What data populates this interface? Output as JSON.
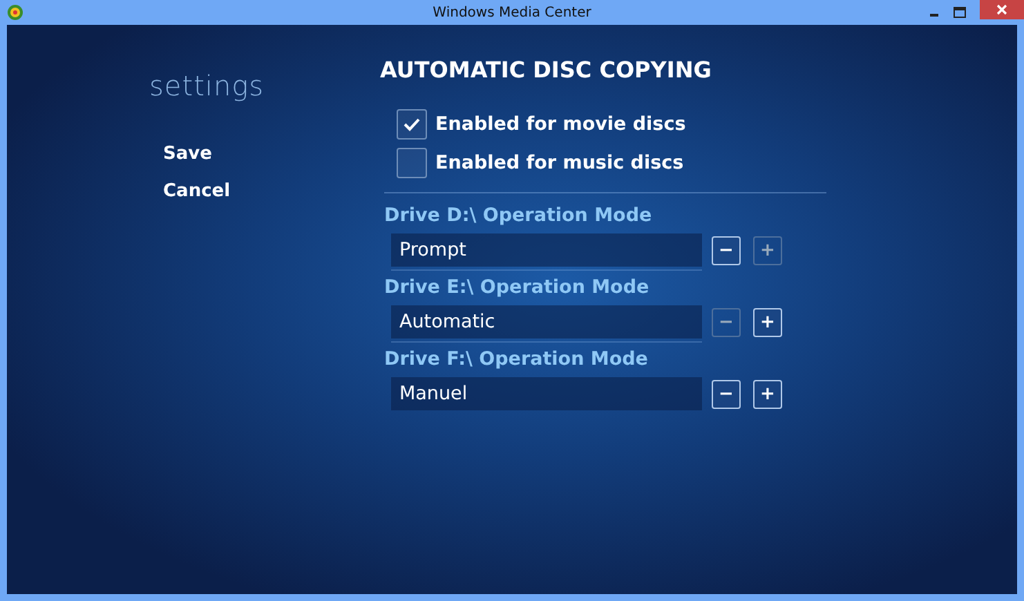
{
  "window": {
    "title": "Windows Media Center"
  },
  "sidebar": {
    "heading": "settings",
    "items": [
      {
        "label": "Save"
      },
      {
        "label": "Cancel"
      }
    ]
  },
  "page_title": "AUTOMATIC DISC COPYING",
  "checkboxes": [
    {
      "label": "Enabled for movie discs",
      "checked": true
    },
    {
      "label": "Enabled for music discs",
      "checked": false
    }
  ],
  "drives": [
    {
      "label": "Drive D:\\ Operation Mode",
      "value": "Prompt",
      "minus": {
        "label": "−",
        "disabled": false
      },
      "plus": {
        "label": "+",
        "disabled": true
      }
    },
    {
      "label": "Drive E:\\ Operation Mode",
      "value": "Automatic",
      "minus": {
        "label": "−",
        "disabled": true
      },
      "plus": {
        "label": "+",
        "disabled": false
      }
    },
    {
      "label": "Drive F:\\ Operation Mode",
      "value": "Manuel",
      "minus": {
        "label": "−",
        "disabled": false
      },
      "plus": {
        "label": "+",
        "disabled": false
      }
    }
  ]
}
